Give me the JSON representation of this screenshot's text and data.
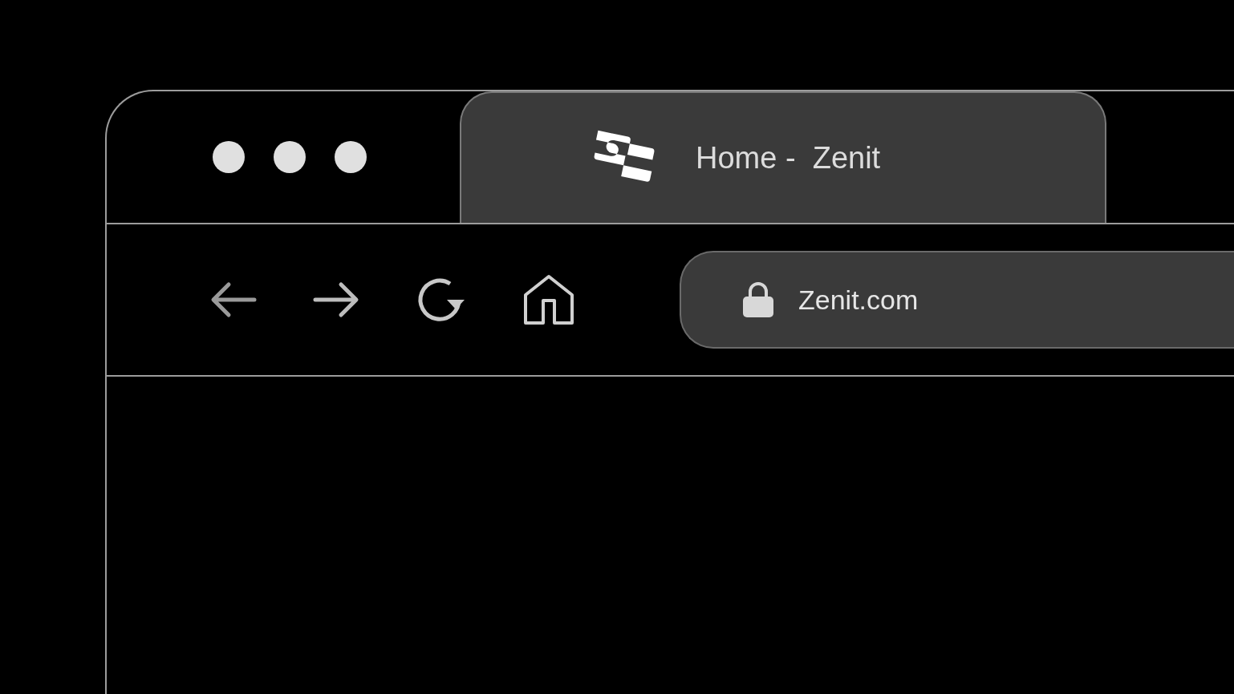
{
  "tabs": [
    {
      "title": "Home -  Zenit",
      "selected": true
    }
  ],
  "toolbar": {
    "buttons": [
      {
        "kind": "back"
      },
      {
        "kind": "forward"
      },
      {
        "kind": "reload"
      },
      {
        "kind": "home"
      }
    ]
  },
  "address_bar": {
    "value": "Zenit.com",
    "secure": true
  }
}
